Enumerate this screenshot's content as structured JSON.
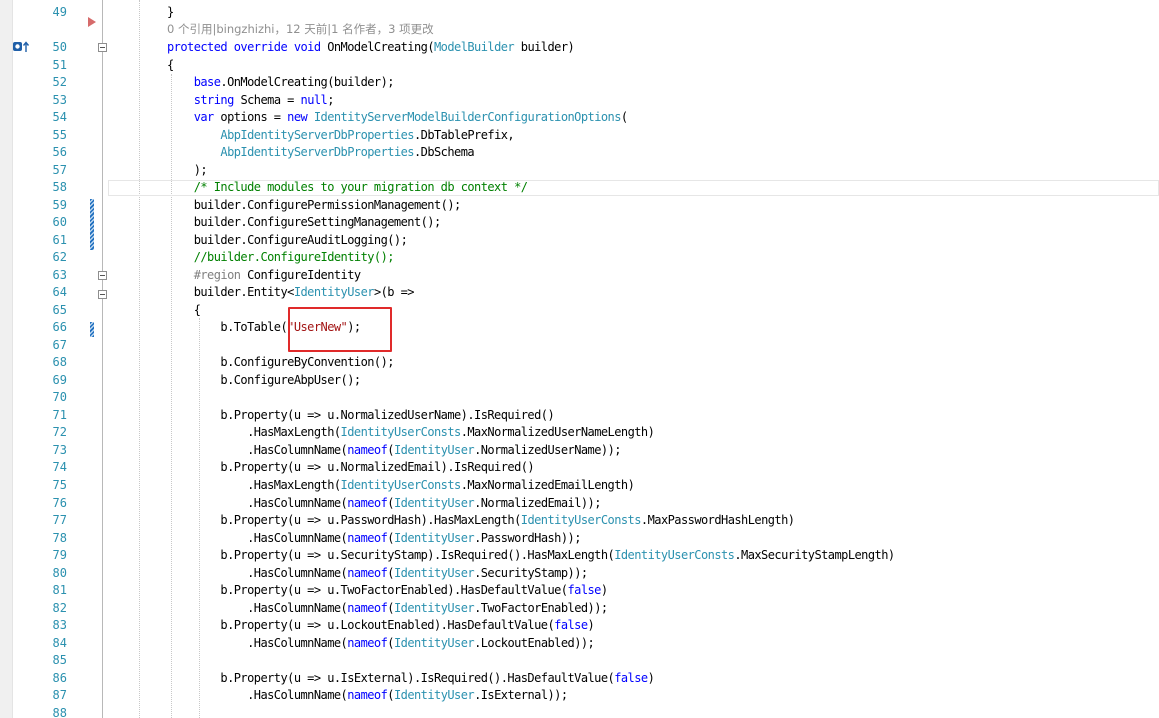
{
  "code_lens": "0 个引用|bingzhizhi，12 天前|1 名作者，3 项更改",
  "lines": [
    {
      "n": "49",
      "tokens": [
        [
          "p",
          "}"
        ]
      ]
    },
    {
      "n": "50",
      "tokens": [
        [
          "kw",
          "protected override void "
        ],
        [
          "p",
          "OnModelCreating("
        ],
        [
          "ty",
          "ModelBuilder"
        ],
        [
          "p",
          " builder)"
        ]
      ]
    },
    {
      "n": "51",
      "tokens": [
        [
          "p",
          "{"
        ]
      ]
    },
    {
      "n": "52",
      "tokens": [
        [
          "p",
          "    "
        ],
        [
          "kw",
          "base"
        ],
        [
          "p",
          ".OnModelCreating(builder);"
        ]
      ]
    },
    {
      "n": "53",
      "tokens": [
        [
          "p",
          "    "
        ],
        [
          "kw",
          "string"
        ],
        [
          "p",
          " Schema = "
        ],
        [
          "kw",
          "null"
        ],
        [
          "p",
          ";"
        ]
      ]
    },
    {
      "n": "54",
      "tokens": [
        [
          "p",
          "    "
        ],
        [
          "kw",
          "var"
        ],
        [
          "p",
          " options = "
        ],
        [
          "kw",
          "new "
        ],
        [
          "ty",
          "IdentityServerModelBuilderConfigurationOptions"
        ],
        [
          "p",
          "("
        ]
      ]
    },
    {
      "n": "55",
      "tokens": [
        [
          "p",
          "        "
        ],
        [
          "ty",
          "AbpIdentityServerDbProperties"
        ],
        [
          "p",
          ".DbTablePrefix,"
        ]
      ]
    },
    {
      "n": "56",
      "tokens": [
        [
          "p",
          "        "
        ],
        [
          "ty",
          "AbpIdentityServerDbProperties"
        ],
        [
          "p",
          ".DbSchema"
        ]
      ]
    },
    {
      "n": "57",
      "tokens": [
        [
          "p",
          "    );"
        ]
      ]
    },
    {
      "n": "58",
      "tokens": [
        [
          "p",
          "    "
        ],
        [
          "cm",
          "/* Include modules to your migration db context */"
        ]
      ]
    },
    {
      "n": "59",
      "tokens": [
        [
          "p",
          "    builder.ConfigurePermissionManagement();"
        ]
      ]
    },
    {
      "n": "60",
      "tokens": [
        [
          "p",
          "    builder.ConfigureSettingManagement();"
        ]
      ]
    },
    {
      "n": "61",
      "tokens": [
        [
          "p",
          "    builder.ConfigureAuditLogging();"
        ]
      ]
    },
    {
      "n": "62",
      "tokens": [
        [
          "p",
          "    "
        ],
        [
          "cm",
          "//builder.ConfigureIdentity();"
        ]
      ]
    },
    {
      "n": "63",
      "tokens": [
        [
          "p",
          "    "
        ],
        [
          "pre",
          "#region"
        ],
        [
          "p",
          " ConfigureIdentity"
        ]
      ]
    },
    {
      "n": "64",
      "tokens": [
        [
          "p",
          "    builder.Entity<"
        ],
        [
          "ty",
          "IdentityUser"
        ],
        [
          "p",
          ">(b =>"
        ]
      ]
    },
    {
      "n": "65",
      "tokens": [
        [
          "p",
          "    {"
        ]
      ]
    },
    {
      "n": "66",
      "tokens": [
        [
          "p",
          "        b.ToTable("
        ],
        [
          "str",
          "\"UserNew\""
        ],
        [
          "p",
          ");"
        ]
      ]
    },
    {
      "n": "67",
      "tokens": []
    },
    {
      "n": "68",
      "tokens": [
        [
          "p",
          "        b.ConfigureByConvention();"
        ]
      ]
    },
    {
      "n": "69",
      "tokens": [
        [
          "p",
          "        b.ConfigureAbpUser();"
        ]
      ]
    },
    {
      "n": "70",
      "tokens": []
    },
    {
      "n": "71",
      "tokens": [
        [
          "p",
          "        b.Property(u => u.NormalizedUserName).IsRequired()"
        ]
      ]
    },
    {
      "n": "72",
      "tokens": [
        [
          "p",
          "            .HasMaxLength("
        ],
        [
          "ty",
          "IdentityUserConsts"
        ],
        [
          "p",
          ".MaxNormalizedUserNameLength)"
        ]
      ]
    },
    {
      "n": "73",
      "tokens": [
        [
          "p",
          "            .HasColumnName("
        ],
        [
          "kw",
          "nameof"
        ],
        [
          "p",
          "("
        ],
        [
          "ty",
          "IdentityUser"
        ],
        [
          "p",
          ".NormalizedUserName));"
        ]
      ]
    },
    {
      "n": "74",
      "tokens": [
        [
          "p",
          "        b.Property(u => u.NormalizedEmail).IsRequired()"
        ]
      ]
    },
    {
      "n": "75",
      "tokens": [
        [
          "p",
          "            .HasMaxLength("
        ],
        [
          "ty",
          "IdentityUserConsts"
        ],
        [
          "p",
          ".MaxNormalizedEmailLength)"
        ]
      ]
    },
    {
      "n": "76",
      "tokens": [
        [
          "p",
          "            .HasColumnName("
        ],
        [
          "kw",
          "nameof"
        ],
        [
          "p",
          "("
        ],
        [
          "ty",
          "IdentityUser"
        ],
        [
          "p",
          ".NormalizedEmail));"
        ]
      ]
    },
    {
      "n": "77",
      "tokens": [
        [
          "p",
          "        b.Property(u => u.PasswordHash).HasMaxLength("
        ],
        [
          "ty",
          "IdentityUserConsts"
        ],
        [
          "p",
          ".MaxPasswordHashLength)"
        ]
      ]
    },
    {
      "n": "78",
      "tokens": [
        [
          "p",
          "            .HasColumnName("
        ],
        [
          "kw",
          "nameof"
        ],
        [
          "p",
          "("
        ],
        [
          "ty",
          "IdentityUser"
        ],
        [
          "p",
          ".PasswordHash));"
        ]
      ]
    },
    {
      "n": "79",
      "tokens": [
        [
          "p",
          "        b.Property(u => u.SecurityStamp).IsRequired().HasMaxLength("
        ],
        [
          "ty",
          "IdentityUserConsts"
        ],
        [
          "p",
          ".MaxSecurityStampLength)"
        ]
      ]
    },
    {
      "n": "80",
      "tokens": [
        [
          "p",
          "            .HasColumnName("
        ],
        [
          "kw",
          "nameof"
        ],
        [
          "p",
          "("
        ],
        [
          "ty",
          "IdentityUser"
        ],
        [
          "p",
          ".SecurityStamp));"
        ]
      ]
    },
    {
      "n": "81",
      "tokens": [
        [
          "p",
          "        b.Property(u => u.TwoFactorEnabled).HasDefaultValue("
        ],
        [
          "kw",
          "false"
        ],
        [
          "p",
          ")"
        ]
      ]
    },
    {
      "n": "82",
      "tokens": [
        [
          "p",
          "            .HasColumnName("
        ],
        [
          "kw",
          "nameof"
        ],
        [
          "p",
          "("
        ],
        [
          "ty",
          "IdentityUser"
        ],
        [
          "p",
          ".TwoFactorEnabled));"
        ]
      ]
    },
    {
      "n": "83",
      "tokens": [
        [
          "p",
          "        b.Property(u => u.LockoutEnabled).HasDefaultValue("
        ],
        [
          "kw",
          "false"
        ],
        [
          "p",
          ")"
        ]
      ]
    },
    {
      "n": "84",
      "tokens": [
        [
          "p",
          "            .HasColumnName("
        ],
        [
          "kw",
          "nameof"
        ],
        [
          "p",
          "("
        ],
        [
          "ty",
          "IdentityUser"
        ],
        [
          "p",
          ".LockoutEnabled));"
        ]
      ]
    },
    {
      "n": "85",
      "tokens": []
    },
    {
      "n": "86",
      "tokens": [
        [
          "p",
          "        b.Property(u => u.IsExternal).IsRequired().HasDefaultValue("
        ],
        [
          "kw",
          "false"
        ],
        [
          "p",
          ")"
        ]
      ]
    },
    {
      "n": "87",
      "tokens": [
        [
          "p",
          "            .HasColumnName("
        ],
        [
          "kw",
          "nameof"
        ],
        [
          "p",
          "("
        ],
        [
          "ty",
          "IdentityUser"
        ],
        [
          "p",
          ".IsExternal));"
        ]
      ]
    },
    {
      "n": "88",
      "tokens": []
    }
  ],
  "colors": {
    "keyword": "#0000ff",
    "type": "#2b91af",
    "string": "#a31515",
    "comment": "#008000",
    "line_number": "#2b91af",
    "highlight_box": "#e02a2a"
  },
  "icons": [
    "breakpoint-arrow-icon",
    "override-indicator-icon",
    "collapse-icon"
  ]
}
